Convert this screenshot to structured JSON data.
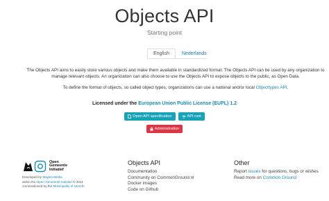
{
  "header": {
    "title": "Objects API",
    "subtitle": "Starting point"
  },
  "tabs": [
    {
      "label": "English",
      "active": true
    },
    {
      "label": "Nederlands",
      "active": false
    }
  ],
  "intro": {
    "p1": "The Objects API aims to easily store various objects and make them available in standardized format. The Objects API can be used by any organization to manage relevant objects. An organization can also choose to use the Objects API to expose objects to the public, as Open Data.",
    "p2_prefix": "To define the format of objects, so called object types, organizations can use a national and/or local ",
    "p2_link": "Objecttypes API",
    "p2_suffix": "."
  },
  "license": {
    "prefix": "Licensed under the ",
    "link": "European Union Public License (EUPL) 1.2"
  },
  "buttons": {
    "spec": "Open API specification",
    "root": "API root",
    "admin": "Administration"
  },
  "footer": {
    "logo_text_1": "Open",
    "logo_text_2": "Gemeente",
    "logo_text_3": "Initiatief",
    "credits_1_prefix": "Developed by ",
    "credits_1_link": "Maykin Media",
    "credits_2_prefix": "within the ",
    "credits_2_link": "Open Gemeente Initiatief",
    "credits_2_suffix": " © 2022",
    "credits_3_prefix": "commissioned by the ",
    "credits_3_link": "Municipality of Utrecht",
    "col1_title": "Objects API",
    "col1_links": [
      "Documentation",
      "Community on CommonGround.nl",
      "Docker images",
      "Code on Github"
    ],
    "col2_title": "Other",
    "col2_line1_prefix": "Report ",
    "col2_line1_link": "issues",
    "col2_line1_suffix": " for questions, bugs or wishes",
    "col2_line2_prefix": "Read more on ",
    "col2_line2_link": "Common Ground"
  },
  "colors": {
    "accent": "#1a8ab6",
    "info": "#17a2b8",
    "danger": "#dc3545"
  },
  "icons": {
    "spec": "file-icon",
    "root": "wifi-icon",
    "admin": "lock-icon"
  }
}
